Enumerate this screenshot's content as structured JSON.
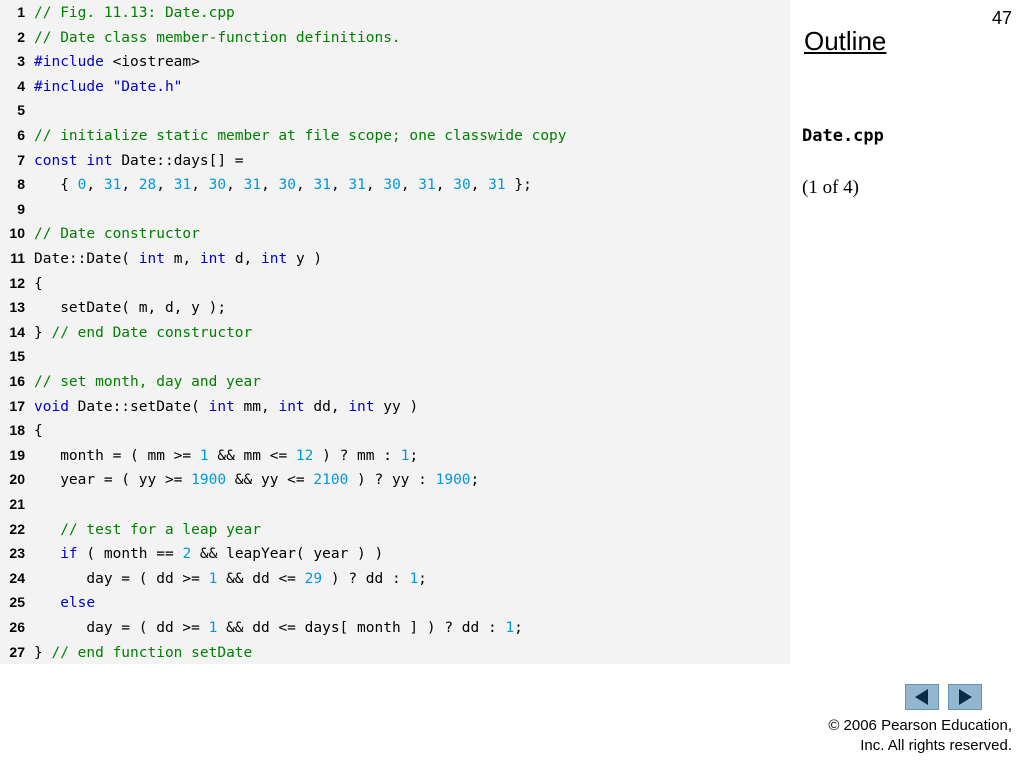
{
  "page_number": "47",
  "outline_label": "Outline",
  "side_panel": {
    "file_name": "Date.cpp",
    "part_label": "(1 of 4)"
  },
  "code_lines": [
    {
      "num": "1",
      "tokens": [
        {
          "t": "c",
          "v": "// Fig. 11.13: Date.cpp"
        }
      ]
    },
    {
      "num": "2",
      "tokens": [
        {
          "t": "c",
          "v": "// Date class member-function definitions."
        }
      ]
    },
    {
      "num": "3",
      "tokens": [
        {
          "t": "k",
          "v": "#include"
        },
        {
          "t": "p",
          "v": " <iostream>"
        }
      ]
    },
    {
      "num": "4",
      "tokens": [
        {
          "t": "k",
          "v": "#include"
        },
        {
          "t": "p",
          "v": " "
        },
        {
          "t": "s",
          "v": "\"Date.h\""
        }
      ]
    },
    {
      "num": "5",
      "tokens": []
    },
    {
      "num": "6",
      "tokens": [
        {
          "t": "c",
          "v": "// initialize static member at file scope; one classwide copy"
        }
      ]
    },
    {
      "num": "7",
      "tokens": [
        {
          "t": "k",
          "v": "const"
        },
        {
          "t": "p",
          "v": " "
        },
        {
          "t": "k",
          "v": "int"
        },
        {
          "t": "p",
          "v": " Date::days[] ="
        }
      ]
    },
    {
      "num": "8",
      "tokens": [
        {
          "t": "p",
          "v": "   { "
        },
        {
          "t": "n",
          "v": "0"
        },
        {
          "t": "p",
          "v": ", "
        },
        {
          "t": "n",
          "v": "31"
        },
        {
          "t": "p",
          "v": ", "
        },
        {
          "t": "n",
          "v": "28"
        },
        {
          "t": "p",
          "v": ", "
        },
        {
          "t": "n",
          "v": "31"
        },
        {
          "t": "p",
          "v": ", "
        },
        {
          "t": "n",
          "v": "30"
        },
        {
          "t": "p",
          "v": ", "
        },
        {
          "t": "n",
          "v": "31"
        },
        {
          "t": "p",
          "v": ", "
        },
        {
          "t": "n",
          "v": "30"
        },
        {
          "t": "p",
          "v": ", "
        },
        {
          "t": "n",
          "v": "31"
        },
        {
          "t": "p",
          "v": ", "
        },
        {
          "t": "n",
          "v": "31"
        },
        {
          "t": "p",
          "v": ", "
        },
        {
          "t": "n",
          "v": "30"
        },
        {
          "t": "p",
          "v": ", "
        },
        {
          "t": "n",
          "v": "31"
        },
        {
          "t": "p",
          "v": ", "
        },
        {
          "t": "n",
          "v": "30"
        },
        {
          "t": "p",
          "v": ", "
        },
        {
          "t": "n",
          "v": "31"
        },
        {
          "t": "p",
          "v": " };"
        }
      ]
    },
    {
      "num": "9",
      "tokens": []
    },
    {
      "num": "10",
      "tokens": [
        {
          "t": "c",
          "v": "// Date constructor"
        }
      ]
    },
    {
      "num": "11",
      "tokens": [
        {
          "t": "p",
          "v": "Date::Date( "
        },
        {
          "t": "k",
          "v": "int"
        },
        {
          "t": "p",
          "v": " m, "
        },
        {
          "t": "k",
          "v": "int"
        },
        {
          "t": "p",
          "v": " d, "
        },
        {
          "t": "k",
          "v": "int"
        },
        {
          "t": "p",
          "v": " y )"
        }
      ]
    },
    {
      "num": "12",
      "tokens": [
        {
          "t": "p",
          "v": "{"
        }
      ]
    },
    {
      "num": "13",
      "tokens": [
        {
          "t": "p",
          "v": "   setDate( m, d, y );"
        }
      ]
    },
    {
      "num": "14",
      "tokens": [
        {
          "t": "p",
          "v": "} "
        },
        {
          "t": "c",
          "v": "// end Date constructor"
        }
      ]
    },
    {
      "num": "15",
      "tokens": []
    },
    {
      "num": "16",
      "tokens": [
        {
          "t": "c",
          "v": "// set month, day and year"
        }
      ]
    },
    {
      "num": "17",
      "tokens": [
        {
          "t": "k",
          "v": "void"
        },
        {
          "t": "p",
          "v": " Date::setDate( "
        },
        {
          "t": "k",
          "v": "int"
        },
        {
          "t": "p",
          "v": " mm, "
        },
        {
          "t": "k",
          "v": "int"
        },
        {
          "t": "p",
          "v": " dd, "
        },
        {
          "t": "k",
          "v": "int"
        },
        {
          "t": "p",
          "v": " yy )"
        }
      ]
    },
    {
      "num": "18",
      "tokens": [
        {
          "t": "p",
          "v": "{"
        }
      ]
    },
    {
      "num": "19",
      "tokens": [
        {
          "t": "p",
          "v": "   month = ( mm >= "
        },
        {
          "t": "n",
          "v": "1"
        },
        {
          "t": "p",
          "v": " && mm <= "
        },
        {
          "t": "n",
          "v": "12"
        },
        {
          "t": "p",
          "v": " ) ? mm : "
        },
        {
          "t": "n",
          "v": "1"
        },
        {
          "t": "p",
          "v": ";"
        }
      ]
    },
    {
      "num": "20",
      "tokens": [
        {
          "t": "p",
          "v": "   year = ( yy >= "
        },
        {
          "t": "n",
          "v": "1900"
        },
        {
          "t": "p",
          "v": " && yy <= "
        },
        {
          "t": "n",
          "v": "2100"
        },
        {
          "t": "p",
          "v": " ) ? yy : "
        },
        {
          "t": "n",
          "v": "1900"
        },
        {
          "t": "p",
          "v": ";"
        }
      ]
    },
    {
      "num": "21",
      "tokens": []
    },
    {
      "num": "22",
      "tokens": [
        {
          "t": "p",
          "v": "   "
        },
        {
          "t": "c",
          "v": "// test for a leap year"
        }
      ]
    },
    {
      "num": "23",
      "tokens": [
        {
          "t": "p",
          "v": "   "
        },
        {
          "t": "k",
          "v": "if"
        },
        {
          "t": "p",
          "v": " ( month == "
        },
        {
          "t": "n",
          "v": "2"
        },
        {
          "t": "p",
          "v": " && leapYear( year ) )"
        }
      ]
    },
    {
      "num": "24",
      "tokens": [
        {
          "t": "p",
          "v": "      day = ( dd >= "
        },
        {
          "t": "n",
          "v": "1"
        },
        {
          "t": "p",
          "v": " && dd <= "
        },
        {
          "t": "n",
          "v": "29"
        },
        {
          "t": "p",
          "v": " ) ? dd : "
        },
        {
          "t": "n",
          "v": "1"
        },
        {
          "t": "p",
          "v": ";"
        }
      ]
    },
    {
      "num": "25",
      "tokens": [
        {
          "t": "p",
          "v": "   "
        },
        {
          "t": "k",
          "v": "else"
        }
      ]
    },
    {
      "num": "26",
      "tokens": [
        {
          "t": "p",
          "v": "      day = ( dd >= "
        },
        {
          "t": "n",
          "v": "1"
        },
        {
          "t": "p",
          "v": " && dd <= days[ month ] ) ? dd : "
        },
        {
          "t": "n",
          "v": "1"
        },
        {
          "t": "p",
          "v": ";"
        }
      ]
    },
    {
      "num": "27",
      "tokens": [
        {
          "t": "p",
          "v": "} "
        },
        {
          "t": "c",
          "v": "// end function setDate"
        }
      ]
    }
  ],
  "nav": {
    "prev_icon": "triangle-left-icon",
    "next_icon": "triangle-right-icon"
  },
  "copyright": {
    "line1": "© 2006 Pearson Education,",
    "line2": "Inc.  All rights reserved."
  },
  "colors": {
    "comment": "#008000",
    "keyword": "#0000cc",
    "number": "#0099dd",
    "code_background": "#f3f3f3",
    "nav_button": "#93b6d1"
  }
}
